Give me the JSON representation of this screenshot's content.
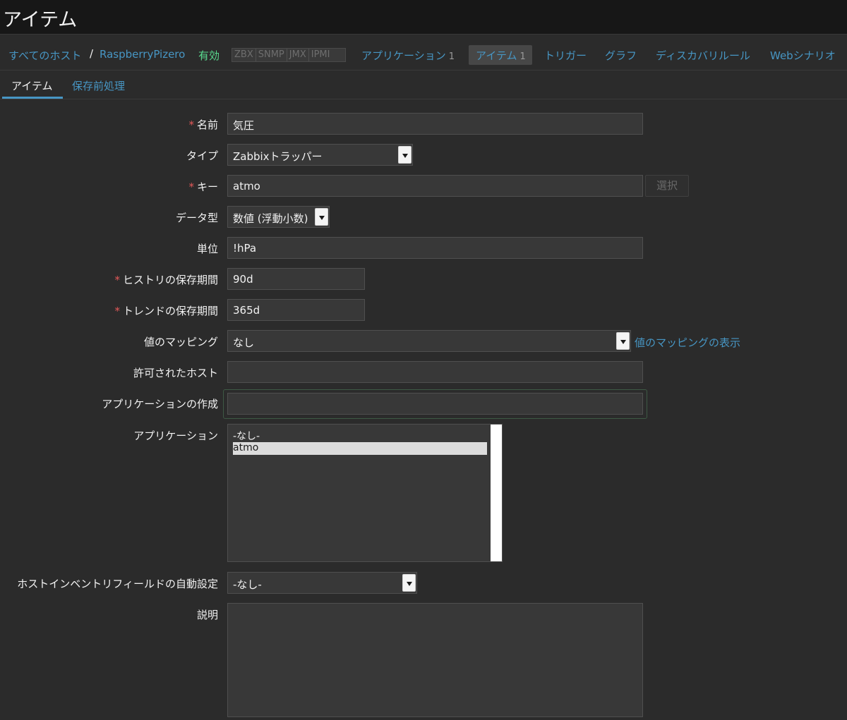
{
  "header": {
    "title": "アイテム"
  },
  "nav": {
    "all_hosts": "すべてのホスト",
    "separator": "/",
    "host": "RaspberryPizero",
    "status": "有効",
    "protocols": [
      "ZBX",
      "SNMP",
      "JMX",
      "IPMI"
    ],
    "applications": {
      "label": "アプリケーション",
      "count": "1"
    },
    "items": {
      "label": "アイテム",
      "count": "1"
    },
    "triggers": "トリガー",
    "graphs": "グラフ",
    "discovery": "ディスカバリルール",
    "web": "Webシナリオ"
  },
  "tabs": {
    "item": "アイテム",
    "preprocessing": "保存前処理"
  },
  "form": {
    "required_mark": "*",
    "name": {
      "label": "名前",
      "value": "気圧"
    },
    "type": {
      "label": "タイプ",
      "value": "Zabbixトラッパー"
    },
    "key": {
      "label": "キー",
      "value": "atmo",
      "button": "選択"
    },
    "data_type": {
      "label": "データ型",
      "value": "数値 (浮動小数)"
    },
    "units": {
      "label": "単位",
      "value": "!hPa"
    },
    "history": {
      "label": "ヒストリの保存期間",
      "value": "90d"
    },
    "trends": {
      "label": "トレンドの保存期間",
      "value": "365d"
    },
    "valuemap": {
      "label": "値のマッピング",
      "value": "なし",
      "link": "値のマッピングの表示"
    },
    "allowed_hosts": {
      "label": "許可されたホスト",
      "value": ""
    },
    "new_application": {
      "label": "アプリケーションの作成",
      "value": ""
    },
    "applications": {
      "label": "アプリケーション",
      "options": [
        "-なし-",
        "atmo"
      ],
      "selected": "atmo"
    },
    "inventory": {
      "label": "ホストインベントリフィールドの自動設定",
      "value": "-なし-"
    },
    "description": {
      "label": "説明",
      "value": ""
    }
  }
}
